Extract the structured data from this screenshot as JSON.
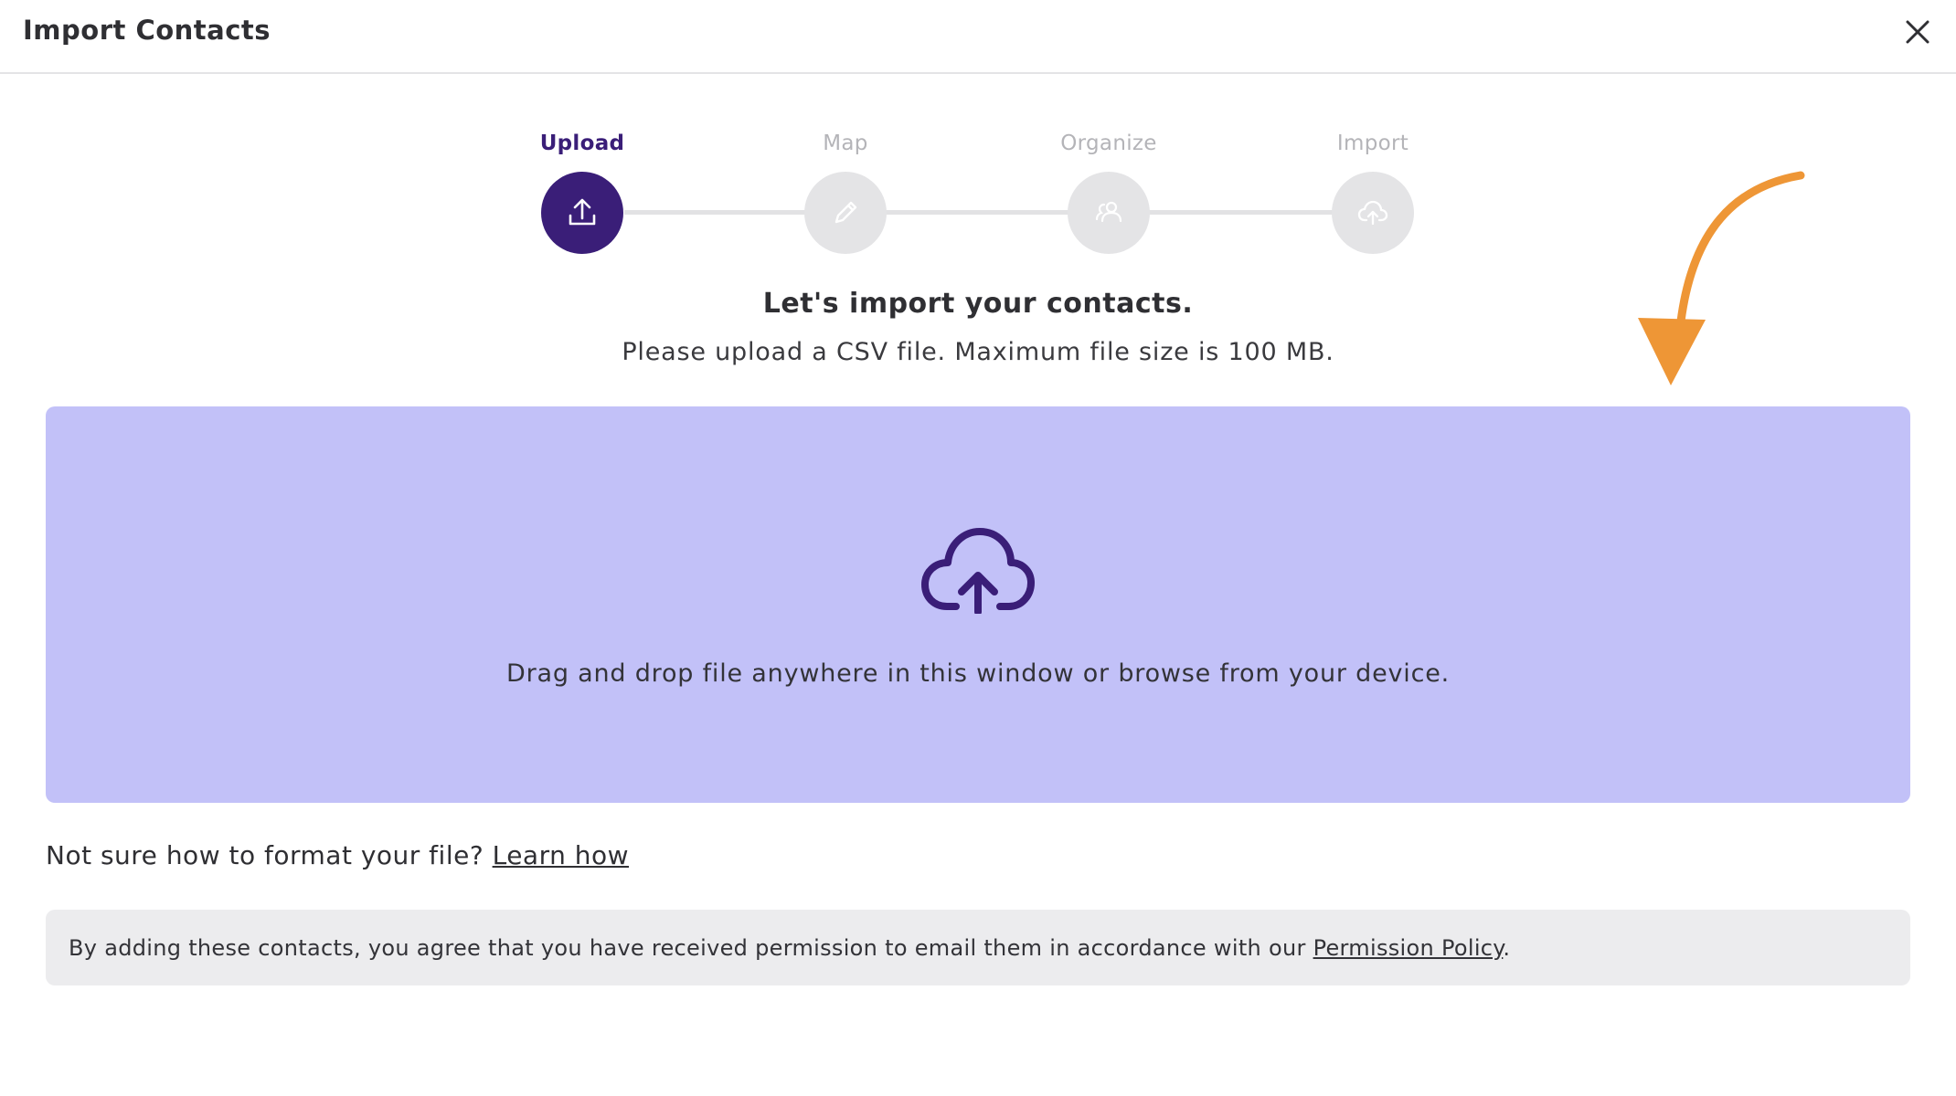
{
  "header": {
    "title": "Import Contacts",
    "close_icon": "close-icon"
  },
  "stepper": {
    "steps": [
      {
        "label": "Upload",
        "icon": "upload-icon",
        "active": true
      },
      {
        "label": "Map",
        "icon": "pencil-icon",
        "active": false
      },
      {
        "label": "Organize",
        "icon": "users-icon",
        "active": false
      },
      {
        "label": "Import",
        "icon": "cloud-upload-icon",
        "active": false
      }
    ]
  },
  "main": {
    "heading": "Let's import your contacts.",
    "subheading": "Please upload a CSV file. Maximum file size is 100 MB.",
    "dropzone_text": "Drag and drop file anywhere in this window or browse from your device.",
    "dropzone_icon": "cloud-upload-icon",
    "help_text": "Not sure how to format your file?",
    "help_link": "Learn how",
    "notice_text": "By adding these contacts, you agree that you have received permission to email them in accordance with our",
    "notice_link": "Permission Policy",
    "notice_end": "."
  },
  "colors": {
    "accent": "#3a1e78",
    "dropzone": "#c2c1f8",
    "notice_bg": "#ececee",
    "annotation": "#ee9636"
  }
}
